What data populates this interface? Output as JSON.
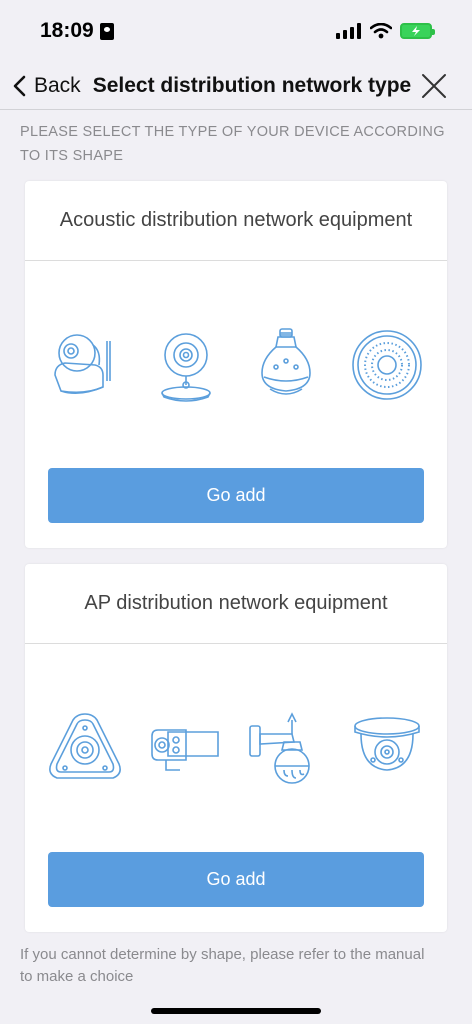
{
  "status": {
    "time": "18:09"
  },
  "nav": {
    "back_label": "Back",
    "title": "Select distribution network type"
  },
  "instruction": "PLEASE SELECT THE TYPE OF YOUR DEVICE ACCORDING TO ITS SHAPE",
  "cards": [
    {
      "title": "Acoustic distribution network equipment",
      "button_label": "Go add"
    },
    {
      "title": "AP distribution network equipment",
      "button_label": "Go add"
    }
  ],
  "footer_note": "If you cannot determine by shape, please refer to the manual to make a choice",
  "colors": {
    "accent": "#5a9ddf",
    "icon_stroke": "#5c9fdc",
    "background": "#f1f0f5"
  }
}
